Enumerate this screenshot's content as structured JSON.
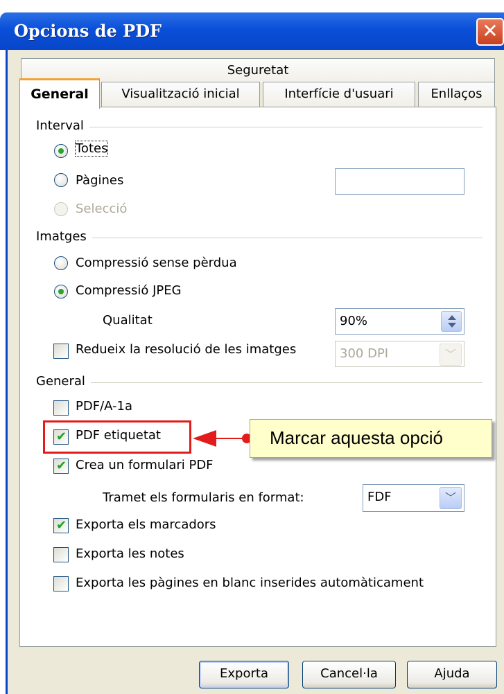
{
  "window": {
    "title": "Opcions de PDF",
    "close_glyph": "✕"
  },
  "tabs": {
    "security": "Seguretat",
    "general": "General",
    "initial_view": "Visualització inicial",
    "user_interface": "Interfície d'usuari",
    "links": "Enllaços"
  },
  "range": {
    "legend": "Interval",
    "all": "Totes",
    "pages": "Pàgines",
    "pages_value": "",
    "selection": "Selecció",
    "selected": "all"
  },
  "images": {
    "legend": "Imatges",
    "lossless": "Compressió sense pèrdua",
    "jpeg": "Compressió JPEG",
    "quality_label": "Qualitat",
    "quality_value": "90%",
    "reduce_label": "Redueix la resolució de les imatges",
    "reduce_checked": false,
    "resolution_value": "300 DPI"
  },
  "general": {
    "legend": "General",
    "pdfa": "PDF/A-1a",
    "pdfa_checked": false,
    "tagged": "PDF etiquetat",
    "tagged_checked": true,
    "create_form": "Crea un formulari PDF",
    "create_form_checked": true,
    "submit_format_label": "Tramet els formularis en format:",
    "submit_format_value": "FDF",
    "export_bookmarks": "Exporta els marcadors",
    "export_bookmarks_checked": true,
    "export_notes": "Exporta les notes",
    "export_notes_checked": false,
    "export_blank": "Exporta les pàgines en blanc inserides automàticament",
    "export_blank_checked": false
  },
  "annotation": {
    "callout_text": "Marcar aquesta opció",
    "highlight_color": "#e31b1b"
  },
  "buttons": {
    "export": "Exporta",
    "cancel": "Cancel·la",
    "help": "Ajuda"
  },
  "icons": {
    "check": "✔",
    "dropdown": "﹀"
  }
}
